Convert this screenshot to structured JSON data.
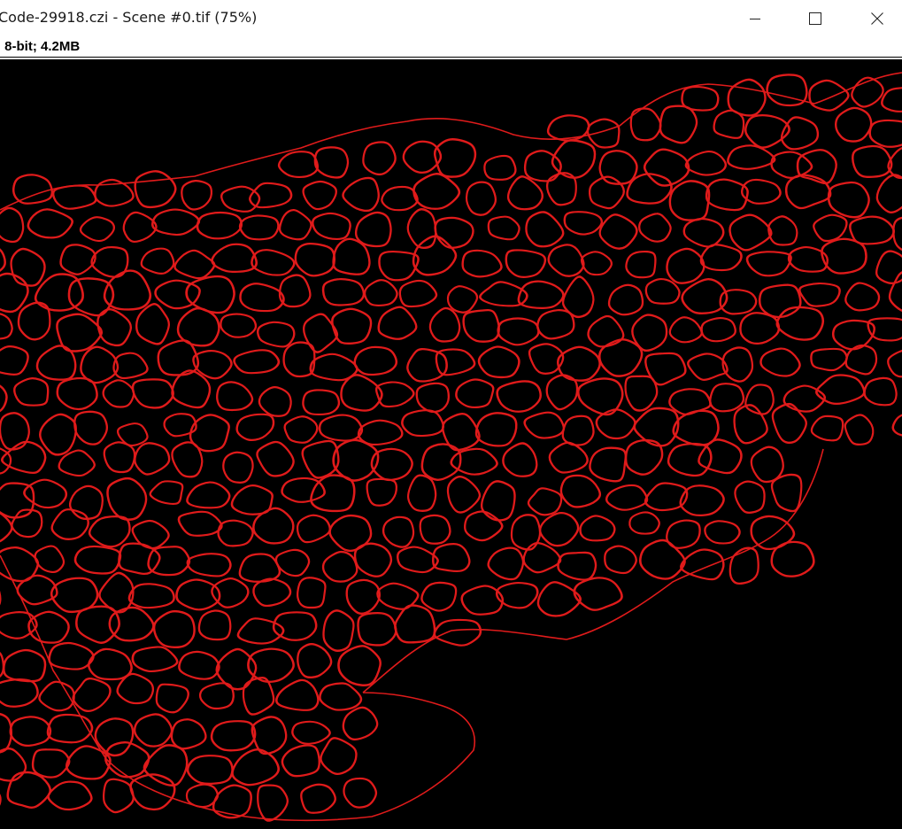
{
  "window": {
    "title": "Code-29918.czi - Scene #0.tif (75%)",
    "controls": {
      "minimize": "minimize",
      "maximize": "maximize",
      "close": "close"
    }
  },
  "image_info": {
    "text": "; 8-bit; 4.2MB"
  },
  "canvas": {
    "background": "#000000",
    "outline_color": "#e01b1b",
    "content": "cell-segmentation-outlines"
  }
}
